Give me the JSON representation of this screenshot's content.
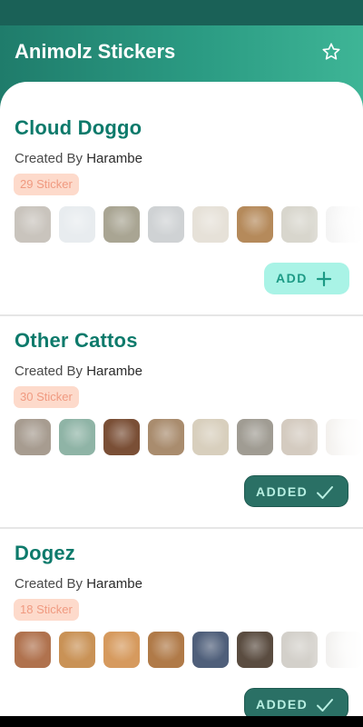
{
  "app_bar": {
    "title": "Animolz Stickers",
    "favorite_icon": "star-outline-icon"
  },
  "packs": [
    {
      "name": "Cloud Doggo",
      "created_by_label": "Created By",
      "author": "Harambe",
      "sticker_count": "29 Sticker",
      "action": {
        "label": "ADD",
        "icon": "plus-icon",
        "state": "not-added"
      },
      "thumb_colors": [
        "#c9c4bd",
        "#e8ecef",
        "#a9a593",
        "#cfd2d4",
        "#e6e1d8",
        "#b58a5b",
        "#d8d6cd",
        "#ececec"
      ]
    },
    {
      "name": "Other Cattos",
      "created_by_label": "Created By",
      "author": "Harambe",
      "sticker_count": "30 Sticker",
      "action": {
        "label": "ADDED",
        "icon": "check-icon",
        "state": "added"
      },
      "thumb_colors": [
        "#a79c90",
        "#8fb4a6",
        "#7a4f36",
        "#a98c6e",
        "#d8cfbd",
        "#a09c93",
        "#d4cbc0",
        "#ebe7e2"
      ]
    },
    {
      "name": "Dogez",
      "created_by_label": "Created By",
      "author": "Harambe",
      "sticker_count": "18 Sticker",
      "action": {
        "label": "ADDED",
        "icon": "check-icon",
        "state": "added"
      },
      "thumb_colors": [
        "#b0724e",
        "#c99256",
        "#d69a5e",
        "#b07a48",
        "#4f5f7a",
        "#5a4c40",
        "#d3d0ca",
        "#e9e7e4"
      ]
    }
  ],
  "colors": {
    "accent": "#0d7a6b",
    "header_start": "#1f7c6b",
    "header_end": "#3eb596",
    "add_bg": "#a9f3e6",
    "added_bg": "#2a7065",
    "count_badge_bg": "#fddacb",
    "count_badge_text": "#f09a80"
  }
}
